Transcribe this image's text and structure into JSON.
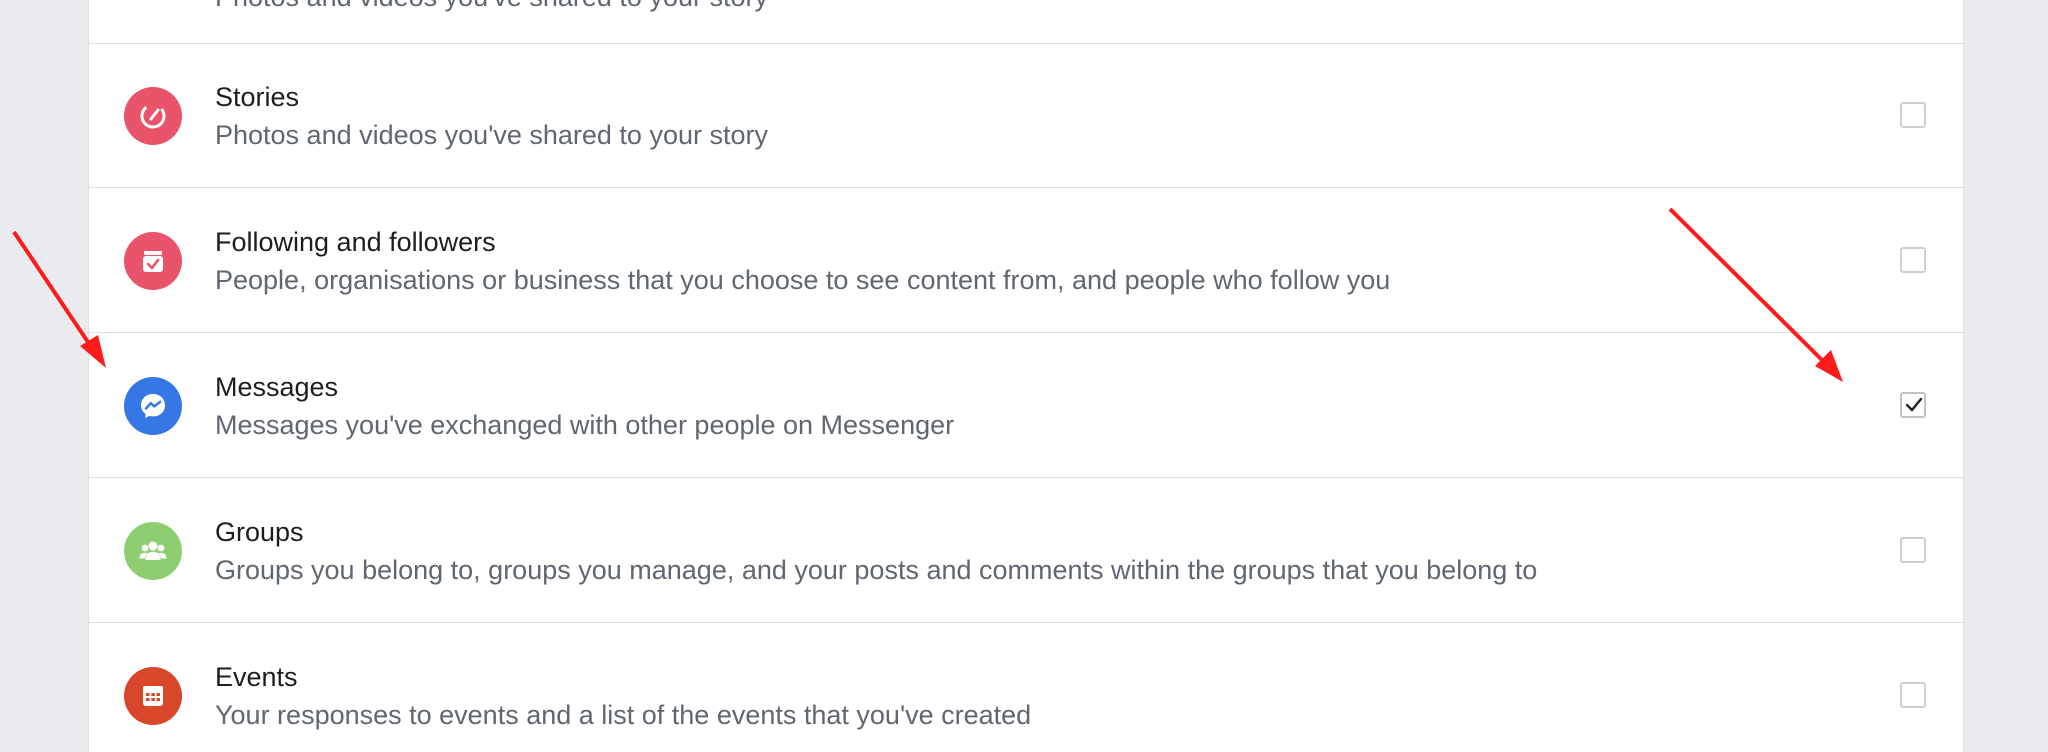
{
  "top_row": {
    "cut_text": "Photos and videos you've shared to your story"
  },
  "items": [
    {
      "title": "Stories",
      "description": "Photos and videos you've shared to your story",
      "icon": "stories-icon",
      "icon_color": "#e9546b",
      "checked": false
    },
    {
      "title": "Following and followers",
      "description": "People, organisations or business that you choose to see content from, and people who follow you",
      "icon": "following-icon",
      "icon_color": "#e9546b",
      "checked": false
    },
    {
      "title": "Messages",
      "description": "Messages you've exchanged with other people on Messenger",
      "icon": "messenger-icon",
      "icon_color": "#3578e5",
      "checked": true
    },
    {
      "title": "Groups",
      "description": "Groups you belong to, groups you manage, and your posts and comments within the groups that you belong to",
      "icon": "groups-icon",
      "icon_color": "#8fce70",
      "checked": false
    },
    {
      "title": "Events",
      "description": "Your responses to events and a list of the events that you've created",
      "icon": "events-icon",
      "icon_color": "#d9472b",
      "checked": false
    }
  ],
  "annotation_color": "#ff1b1b"
}
